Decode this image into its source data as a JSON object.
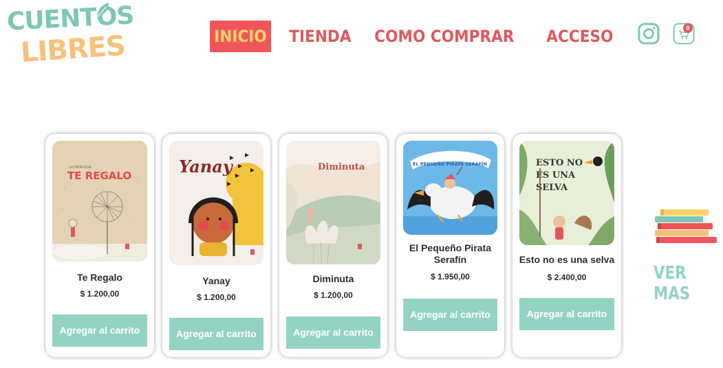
{
  "brand": {
    "line1": "CUENTOS",
    "line2": "LIBRES"
  },
  "nav": {
    "items": [
      {
        "label": "INICIO",
        "active": true
      },
      {
        "label": "TIENDA",
        "active": false
      },
      {
        "label": "COMO COMPRAR",
        "active": false
      },
      {
        "label": "ACCESO",
        "active": false
      }
    ]
  },
  "header": {
    "cart_count": "0"
  },
  "colors": {
    "accent": "#f0555c",
    "teal": "#93d3c4",
    "logo_teal": "#7cc8b3",
    "logo_orange": "#f6c27a"
  },
  "products": [
    {
      "title": "Te Regalo",
      "price": "$ 1.200,00",
      "button": "Agregar al carrito",
      "cover_text": "TE REGALO"
    },
    {
      "title": "Yanay",
      "price": "$ 1.200,00",
      "button": "Agregar al carrito",
      "cover_text": "Yanay"
    },
    {
      "title": "Diminuta",
      "price": "$ 1.200,00",
      "button": "Agregar al carrito",
      "cover_text": "Diminuta"
    },
    {
      "title": "El Pequeño Pirata Serafín",
      "price": "$ 1.950,00",
      "button": "Agregar al carrito",
      "cover_text": "EL PEQUEÑO PIRATA SERAFÍN"
    },
    {
      "title": "Esto no es una selva",
      "price": "$ 2.400,00",
      "button": "Agregar al carrito",
      "cover_text": "ESTO NO ES UNA SELVA"
    }
  ],
  "more": {
    "label": "VER MAS"
  }
}
